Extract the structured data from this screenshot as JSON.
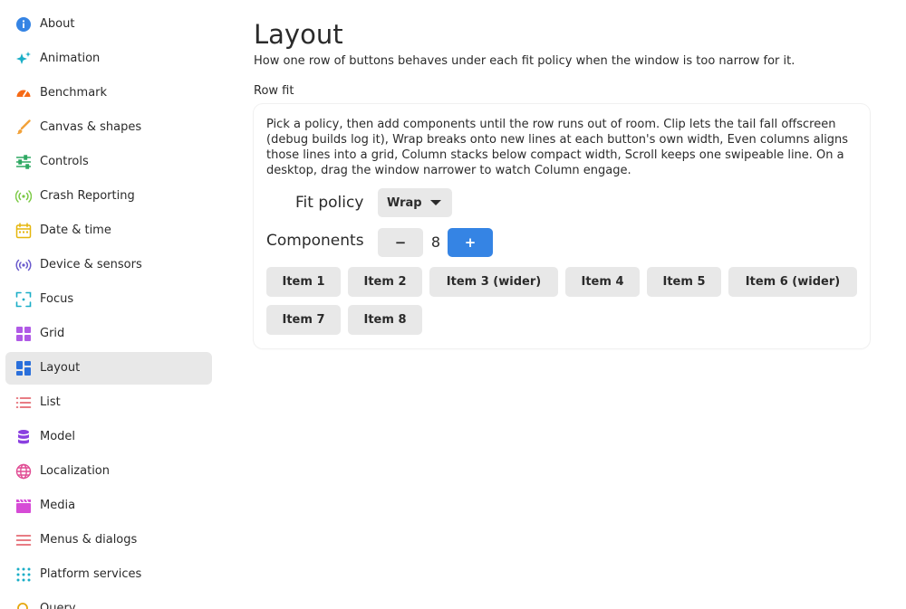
{
  "sidebar": {
    "items": [
      {
        "label": "About",
        "icon": "info-icon",
        "color": "#3584e4"
      },
      {
        "label": "Animation",
        "icon": "sparkles-icon",
        "color": "#1aaec7"
      },
      {
        "label": "Benchmark",
        "icon": "speedometer-icon",
        "color": "#f66a16"
      },
      {
        "label": "Canvas & shapes",
        "icon": "brush-icon",
        "color": "#f2a23a"
      },
      {
        "label": "Controls",
        "icon": "sliders-icon",
        "color": "#2ea862"
      },
      {
        "label": "Crash Reporting",
        "icon": "broadcast-icon",
        "color": "#7ac943"
      },
      {
        "label": "Date & time",
        "icon": "calendar-icon",
        "color": "#e5b60c"
      },
      {
        "label": "Device & sensors",
        "icon": "radio-waves-icon",
        "color": "#6a5acd"
      },
      {
        "label": "Focus",
        "icon": "focus-frame-icon",
        "color": "#1aaec7"
      },
      {
        "label": "Grid",
        "icon": "grid-icon",
        "color": "#b05ae6"
      },
      {
        "label": "Layout",
        "icon": "layout-icon",
        "color": "#2a6fdb"
      },
      {
        "label": "List",
        "icon": "list-icon",
        "color": "#e0515b"
      },
      {
        "label": "Model",
        "icon": "database-icon",
        "color": "#8a3fe0"
      },
      {
        "label": "Localization",
        "icon": "globe-icon",
        "color": "#e04c94"
      },
      {
        "label": "Media",
        "icon": "clapperboard-icon",
        "color": "#d64bd6"
      },
      {
        "label": "Menus & dialogs",
        "icon": "menu-icon",
        "color": "#e0515b"
      },
      {
        "label": "Platform services",
        "icon": "dots-grid-icon",
        "color": "#1aaec7"
      },
      {
        "label": "Query",
        "icon": "query-icon",
        "color": "#e5a60c"
      }
    ],
    "selected_label": "Layout",
    "selected_background": "#e8e8e8"
  },
  "main": {
    "title": "Layout",
    "subtitle": "How one row of buttons behaves under each fit policy when the window is too narrow for it.",
    "section_label": "Row fit",
    "card": {
      "description": "Pick a policy, then add components until the row runs out of room. Clip lets the tail fall offscreen (debug builds log it), Wrap breaks onto new lines at each button's own width, Even columns aligns those lines into a grid, Column stacks below compact width, Scroll keeps one swipeable line. On a desktop, drag the window narrower to watch Column engage.",
      "fit_policy_label": "Fit policy",
      "fit_policy_value": "Wrap",
      "components_label": "Components",
      "stepper": {
        "minus_label": "−",
        "plus_label": "+",
        "value": "8"
      },
      "items": [
        "Item 1",
        "Item 2",
        "Item 3 (wider)",
        "Item 4",
        "Item 5",
        "Item 6 (wider)",
        "Item 7",
        "Item 8"
      ]
    }
  },
  "colors": {
    "accent": "#3584e4",
    "button_bg": "#e8e8e8",
    "text": "#2b2b2b"
  }
}
